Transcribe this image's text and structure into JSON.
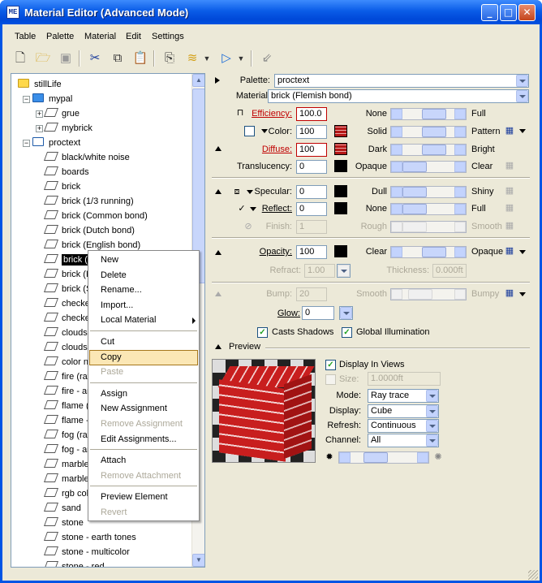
{
  "window": {
    "title": "Material Editor (Advanced Mode)",
    "icon_text": "ME"
  },
  "menu": [
    "Table",
    "Palette",
    "Material",
    "Edit",
    "Settings"
  ],
  "tree": {
    "items": [
      {
        "label": "stillLife",
        "level": 0,
        "kind": "folder"
      },
      {
        "label": "mypal",
        "level": 1,
        "kind": "folder-blue",
        "expanded": true
      },
      {
        "label": "grue",
        "level": 2,
        "kind": "material",
        "expander": "+"
      },
      {
        "label": "mybrick",
        "level": 2,
        "kind": "material",
        "expander": "+"
      },
      {
        "label": "proctext",
        "level": 1,
        "kind": "folder-open",
        "expanded": true
      },
      {
        "label": "black/white noise",
        "level": 2,
        "kind": "material"
      },
      {
        "label": "boards",
        "level": 2,
        "kind": "material"
      },
      {
        "label": "brick",
        "level": 2,
        "kind": "material"
      },
      {
        "label": "brick (1/3 running)",
        "level": 2,
        "kind": "material"
      },
      {
        "label": "brick (Common bond)",
        "level": 2,
        "kind": "material"
      },
      {
        "label": "brick (Dutch bond)",
        "level": 2,
        "kind": "material"
      },
      {
        "label": "brick (English bond)",
        "level": 2,
        "kind": "material"
      },
      {
        "label": "brick (F",
        "level": 2,
        "kind": "material",
        "selected": true
      },
      {
        "label": "brick (F",
        "level": 2,
        "kind": "material"
      },
      {
        "label": "brick (S",
        "level": 2,
        "kind": "material"
      },
      {
        "label": "checke",
        "level": 2,
        "kind": "material"
      },
      {
        "label": "checke",
        "level": 2,
        "kind": "material"
      },
      {
        "label": "clouds",
        "level": 2,
        "kind": "material"
      },
      {
        "label": "clouds",
        "level": 2,
        "kind": "material"
      },
      {
        "label": "color n",
        "level": 2,
        "kind": "material"
      },
      {
        "label": "fire (ray",
        "level": 2,
        "kind": "material"
      },
      {
        "label": "fire - ar",
        "level": 2,
        "kind": "material"
      },
      {
        "label": "flame (",
        "level": 2,
        "kind": "material"
      },
      {
        "label": "flame -",
        "level": 2,
        "kind": "material"
      },
      {
        "label": "fog (ray",
        "level": 2,
        "kind": "material"
      },
      {
        "label": "fog - ar",
        "level": 2,
        "kind": "material"
      },
      {
        "label": "marble",
        "level": 2,
        "kind": "material"
      },
      {
        "label": "marble",
        "level": 2,
        "kind": "material"
      },
      {
        "label": "rgb col",
        "level": 2,
        "kind": "material"
      },
      {
        "label": "sand",
        "level": 2,
        "kind": "material"
      },
      {
        "label": "stone",
        "level": 2,
        "kind": "material"
      },
      {
        "label": "stone - earth tones",
        "level": 2,
        "kind": "material"
      },
      {
        "label": "stone - multicolor",
        "level": 2,
        "kind": "material"
      },
      {
        "label": "stone - red",
        "level": 2,
        "kind": "material"
      }
    ]
  },
  "context_menu": {
    "items": [
      {
        "label": "New",
        "enabled": true
      },
      {
        "label": "Delete",
        "enabled": true
      },
      {
        "label": "Rename...",
        "enabled": true
      },
      {
        "label": "Import...",
        "enabled": true
      },
      {
        "label": "Local Material",
        "enabled": true,
        "submenu": true
      },
      {
        "sep": true
      },
      {
        "label": "Cut",
        "enabled": true
      },
      {
        "label": "Copy",
        "enabled": true,
        "highlighted": true
      },
      {
        "label": "Paste",
        "enabled": false
      },
      {
        "sep": true
      },
      {
        "label": "Assign",
        "enabled": true
      },
      {
        "label": "New Assignment",
        "enabled": true
      },
      {
        "label": "Remove Assignment",
        "enabled": false
      },
      {
        "label": "Edit Assignments...",
        "enabled": true
      },
      {
        "sep": true
      },
      {
        "label": "Attach",
        "enabled": true
      },
      {
        "label": "Remove Attachment",
        "enabled": false
      },
      {
        "sep": true
      },
      {
        "label": "Preview Element",
        "enabled": true
      },
      {
        "label": "Revert",
        "enabled": false
      }
    ]
  },
  "props": {
    "palette_label": "Palette:",
    "palette_value": "proctext",
    "material_label": "Material:",
    "material_value": "brick (Flemish bond)",
    "efficiency": {
      "label": "Efficiency:",
      "value": "100.0",
      "left": "None",
      "right": "Full",
      "level": 0.72
    },
    "color": {
      "label": "Color:",
      "value": "100",
      "left": "Solid",
      "right": "Pattern",
      "level": 0.72
    },
    "diffuse": {
      "label": "Diffuse:",
      "value": "100",
      "left": "Dark",
      "right": "Bright",
      "level": 0.72
    },
    "translucency": {
      "label": "Translucency:",
      "value": "0",
      "left": "Opaque",
      "right": "Clear",
      "level": 0.0
    },
    "specular": {
      "label": "Specular:",
      "value": "0",
      "left": "Dull",
      "right": "Shiny",
      "level": 0.0
    },
    "reflect": {
      "label": "Reflect:",
      "value": "0",
      "left": "None",
      "right": "Full",
      "level": 0.0
    },
    "finish": {
      "label": "Finish:",
      "value": "1",
      "left": "Rough",
      "right": "Smooth",
      "level": 0.0,
      "disabled": true
    },
    "opacity": {
      "label": "Opacity:",
      "value": "100",
      "left": "Clear",
      "right": "Opaque",
      "level": 0.72
    },
    "refract": {
      "label": "Refract:",
      "value": "1.00"
    },
    "thickness": {
      "label": "Thickness:",
      "value": "0.000ft"
    },
    "bump": {
      "label": "Bump:",
      "value": "20",
      "left": "Smooth",
      "right": "Bumpy",
      "level": 0.2,
      "disabled": true
    },
    "glow": {
      "label": "Glow:",
      "value": "0"
    },
    "casts_shadows": {
      "label": "Casts Shadows",
      "checked": true
    },
    "global_illumination": {
      "label": "Global Illumination",
      "checked": true
    }
  },
  "preview": {
    "section_label": "Preview",
    "display_in_views": {
      "label": "Display In Views",
      "checked": true
    },
    "size": {
      "label": "Size:",
      "value": "1.0000ft",
      "checked": false
    },
    "mode": {
      "label": "Mode:",
      "value": "Ray trace"
    },
    "display": {
      "label": "Display:",
      "value": "Cube"
    },
    "refresh": {
      "label": "Refresh:",
      "value": "Continuous"
    },
    "channel": {
      "label": "Channel:",
      "value": "All"
    },
    "brightness_level": 0.3
  },
  "colors": {
    "accent": "#0055e5",
    "red_label": "#c00000",
    "selection": "#000000",
    "menu_highlight": "#fbe7b5"
  }
}
